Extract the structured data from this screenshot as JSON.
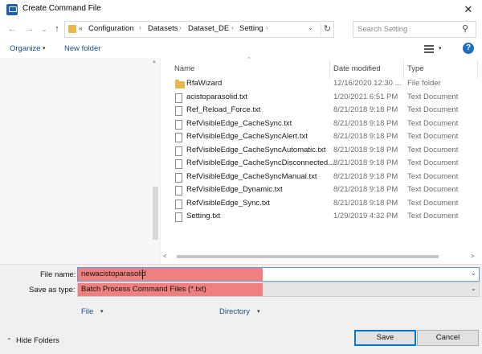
{
  "window": {
    "title": "Create Command File",
    "close": "✕"
  },
  "nav": {
    "back": "←",
    "forward": "→",
    "recent": "⌄",
    "up": "↑"
  },
  "address": {
    "overflow": "«",
    "crumbs": [
      "Configuration",
      "Datasets",
      "Dataset_DE",
      "Setting"
    ],
    "separator": "›",
    "dropdown": "⌄",
    "refresh": "↻"
  },
  "search": {
    "placeholder": "Search Setting",
    "icon": "⚲"
  },
  "toolbar": {
    "organize": "Organize",
    "organize_arrow": "▾",
    "new_folder": "New folder",
    "view_arrow": "▾",
    "help": "?"
  },
  "columns": {
    "name": "Name",
    "date": "Date modified",
    "type": "Type",
    "sort_indicator": "⌃"
  },
  "files": [
    {
      "name": "RfaWizard",
      "date": "12/16/2020 12:30 ...",
      "type": "File folder",
      "kind": "folder"
    },
    {
      "name": "acistoparasolid.txt",
      "date": "1/20/2021 6:51 PM",
      "type": "Text Document",
      "kind": "file"
    },
    {
      "name": "Ref_Reload_Force.txt",
      "date": "8/21/2018 9:18 PM",
      "type": "Text Document",
      "kind": "file"
    },
    {
      "name": "RefVisibleEdge_CacheSync.txt",
      "date": "8/21/2018 9:18 PM",
      "type": "Text Document",
      "kind": "file"
    },
    {
      "name": "RefVisibleEdge_CacheSyncAlert.txt",
      "date": "8/21/2018 9:18 PM",
      "type": "Text Document",
      "kind": "file"
    },
    {
      "name": "RefVisibleEdge_CacheSyncAutomatic.txt",
      "date": "8/21/2018 9:18 PM",
      "type": "Text Document",
      "kind": "file"
    },
    {
      "name": "RefVisibleEdge_CacheSyncDisconnected....",
      "date": "8/21/2018 9:18 PM",
      "type": "Text Document",
      "kind": "file"
    },
    {
      "name": "RefVisibleEdge_CacheSyncManual.txt",
      "date": "8/21/2018 9:18 PM",
      "type": "Text Document",
      "kind": "file"
    },
    {
      "name": "RefVisibleEdge_Dynamic.txt",
      "date": "8/21/2018 9:18 PM",
      "type": "Text Document",
      "kind": "file"
    },
    {
      "name": "RefVisibleEdge_Sync.txt",
      "date": "8/21/2018 9:18 PM",
      "type": "Text Document",
      "kind": "file"
    },
    {
      "name": "Setting.txt",
      "date": "1/29/2019 4:32 PM",
      "type": "Text Document",
      "kind": "file"
    }
  ],
  "hscroll": {
    "left": "<",
    "right": ">"
  },
  "form": {
    "file_name_label": "File name:",
    "file_name_value": "newacistoparasolid",
    "save_as_label": "Save as type:",
    "save_as_value": "Batch Process Command Files (*.txt)",
    "dropdown_arrow": "⌄",
    "highlight_color": "#f08080"
  },
  "links": {
    "file": "File",
    "directory": "Directory",
    "arrow": "▾"
  },
  "footer": {
    "hide_folders": "Hide Folders",
    "hide_arrow": "⌃",
    "save": "Save",
    "cancel": "Cancel"
  }
}
